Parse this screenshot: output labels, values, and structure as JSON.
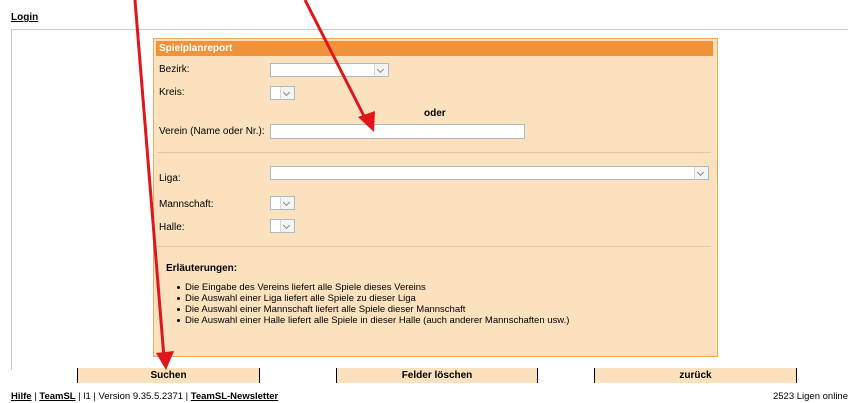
{
  "header": {
    "login": "Login"
  },
  "panel": {
    "title": "Spielplanreport",
    "bezirk_label": "Bezirk:",
    "kreis_label": "Kreis:",
    "oder": "oder",
    "verein_label": "Verein (Name oder Nr.):",
    "verein_value": "",
    "liga_label": "Liga:",
    "mannschaft_label": "Mannschaft:",
    "halle_label": "Halle:"
  },
  "explanations": {
    "title": "Erläuterungen:",
    "items": [
      "Die Eingabe des Vereins liefert alle Spiele dieses Vereins",
      "Die Auswahl einer Liga liefert alle Spiele zu dieser Liga",
      "Die Auswahl einer Mannschaft liefert alle Spiele dieser Mannschaft",
      "Die Auswahl einer Halle liefert alle Spiele in dieser Halle (auch anderer Mannschaften usw.)"
    ]
  },
  "buttons": {
    "search": "Suchen",
    "clear": "Felder löschen",
    "back": "zurück"
  },
  "footer": {
    "hilfe": "Hilfe",
    "teamsl": "TeamSL",
    "sep1": " | ",
    "sep2": " | l1 | Version 9.35.5.2371 | ",
    "newsletter": "TeamSL-Newsletter",
    "leagues_online": "2523 Ligen online"
  },
  "colors": {
    "header_orange": "#f0923a",
    "panel_bg": "#fbe1bd",
    "annotation_arrow": "#e0161b"
  }
}
